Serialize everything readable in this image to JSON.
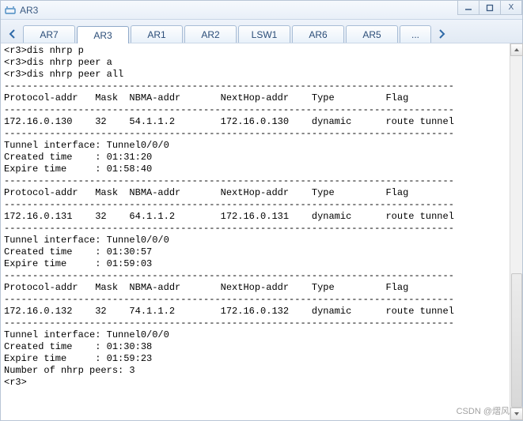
{
  "window": {
    "title": "AR3",
    "min": "—",
    "max": "❐",
    "close": "X"
  },
  "tabs": {
    "items": [
      {
        "label": "AR7",
        "active": false
      },
      {
        "label": "AR3",
        "active": true
      },
      {
        "label": "AR1",
        "active": false
      },
      {
        "label": "AR2",
        "active": false
      },
      {
        "label": "LSW1",
        "active": false
      },
      {
        "label": "AR6",
        "active": false
      },
      {
        "label": "AR5",
        "active": false
      },
      {
        "label": "...",
        "active": false
      }
    ]
  },
  "terminal": {
    "lines": [
      "<r3>dis nhrp p",
      "<r3>dis nhrp peer a",
      "<r3>dis nhrp peer all",
      "",
      "-------------------------------------------------------------------------------",
      "Protocol-addr   Mask  NBMA-addr       NextHop-addr    Type         Flag",
      "-------------------------------------------------------------------------------",
      "172.16.0.130    32    54.1.1.2        172.16.0.130    dynamic      route tunnel",
      "-------------------------------------------------------------------------------",
      "Tunnel interface: Tunnel0/0/0",
      "Created time    : 01:31:20",
      "Expire time     : 01:58:40",
      "",
      "-------------------------------------------------------------------------------",
      "Protocol-addr   Mask  NBMA-addr       NextHop-addr    Type         Flag",
      "-------------------------------------------------------------------------------",
      "172.16.0.131    32    64.1.1.2        172.16.0.131    dynamic      route tunnel",
      "-------------------------------------------------------------------------------",
      "Tunnel interface: Tunnel0/0/0",
      "Created time    : 01:30:57",
      "Expire time     : 01:59:03",
      "",
      "-------------------------------------------------------------------------------",
      "Protocol-addr   Mask  NBMA-addr       NextHop-addr    Type         Flag",
      "-------------------------------------------------------------------------------",
      "172.16.0.132    32    74.1.1.2        172.16.0.132    dynamic      route tunnel",
      "-------------------------------------------------------------------------------",
      "Tunnel interface: Tunnel0/0/0",
      "Created time    : 01:30:38",
      "Expire time     : 01:59:23",
      "",
      "Number of nhrp peers: 3",
      "<r3>"
    ]
  },
  "watermark": "CSDN @熠风"
}
